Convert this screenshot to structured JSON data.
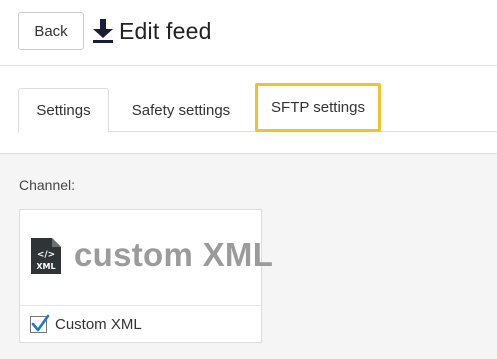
{
  "header": {
    "back_label": "Back",
    "title_icon": "download-icon",
    "title": "Edit feed"
  },
  "tabs": [
    {
      "label": "Settings",
      "active": true
    },
    {
      "label": "Safety settings",
      "active": false
    },
    {
      "label": "SFTP settings",
      "active": false,
      "highlighted": true
    }
  ],
  "colors": {
    "highlight": "#f2c12e",
    "logo_text": "#9b9b9b",
    "check": "#1f7ac9"
  },
  "channel": {
    "label": "Channel:",
    "logo_icon": "xml-file-icon",
    "logo_icon_text": "XML",
    "logo_text": "custom XML",
    "option_label": "Custom XML",
    "checked": true
  }
}
